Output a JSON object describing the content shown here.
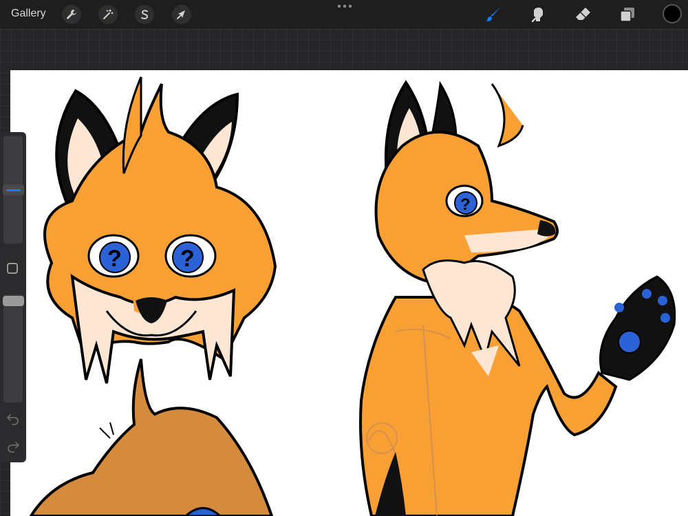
{
  "toolbar": {
    "gallery_label": "Gallery",
    "left_tools": [
      {
        "icon": "wrench-icon",
        "name": "actions"
      },
      {
        "icon": "magic-wand-icon",
        "name": "adjustments"
      },
      {
        "icon": "selection-s-icon",
        "name": "selection"
      },
      {
        "icon": "arrow-cursor-icon",
        "name": "transform"
      }
    ],
    "right_tools": [
      {
        "icon": "brush-icon",
        "name": "paint",
        "active": true
      },
      {
        "icon": "smudge-icon",
        "name": "smudge",
        "active": false
      },
      {
        "icon": "eraser-icon",
        "name": "erase",
        "active": false
      },
      {
        "icon": "layers-icon",
        "name": "layers",
        "active": false
      }
    ],
    "current_color": "#000000",
    "accent_color": "#1a7cf5"
  },
  "sidebar": {
    "brush_size_level": 0.45,
    "opacity_level": 1.0,
    "modify_icon": "square-icon",
    "undo_icon": "undo-icon",
    "redo_icon": "redo-icon"
  },
  "canvas": {
    "background": "#ffffff",
    "artwork": "fox-character-sketch"
  }
}
